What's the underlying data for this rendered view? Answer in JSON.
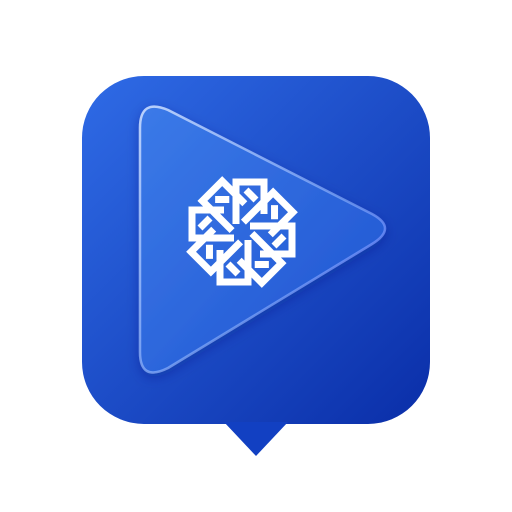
{
  "app_icon": {
    "icon": "video-play-bubble-icon",
    "colors": {
      "background": "#ffffff",
      "bubble_light": "#2f6be6",
      "bubble_dark": "#0a2ea8",
      "play_fill": "#2a63dc",
      "play_edge": "#8fb4ff",
      "emblem": "#ffffff"
    }
  }
}
